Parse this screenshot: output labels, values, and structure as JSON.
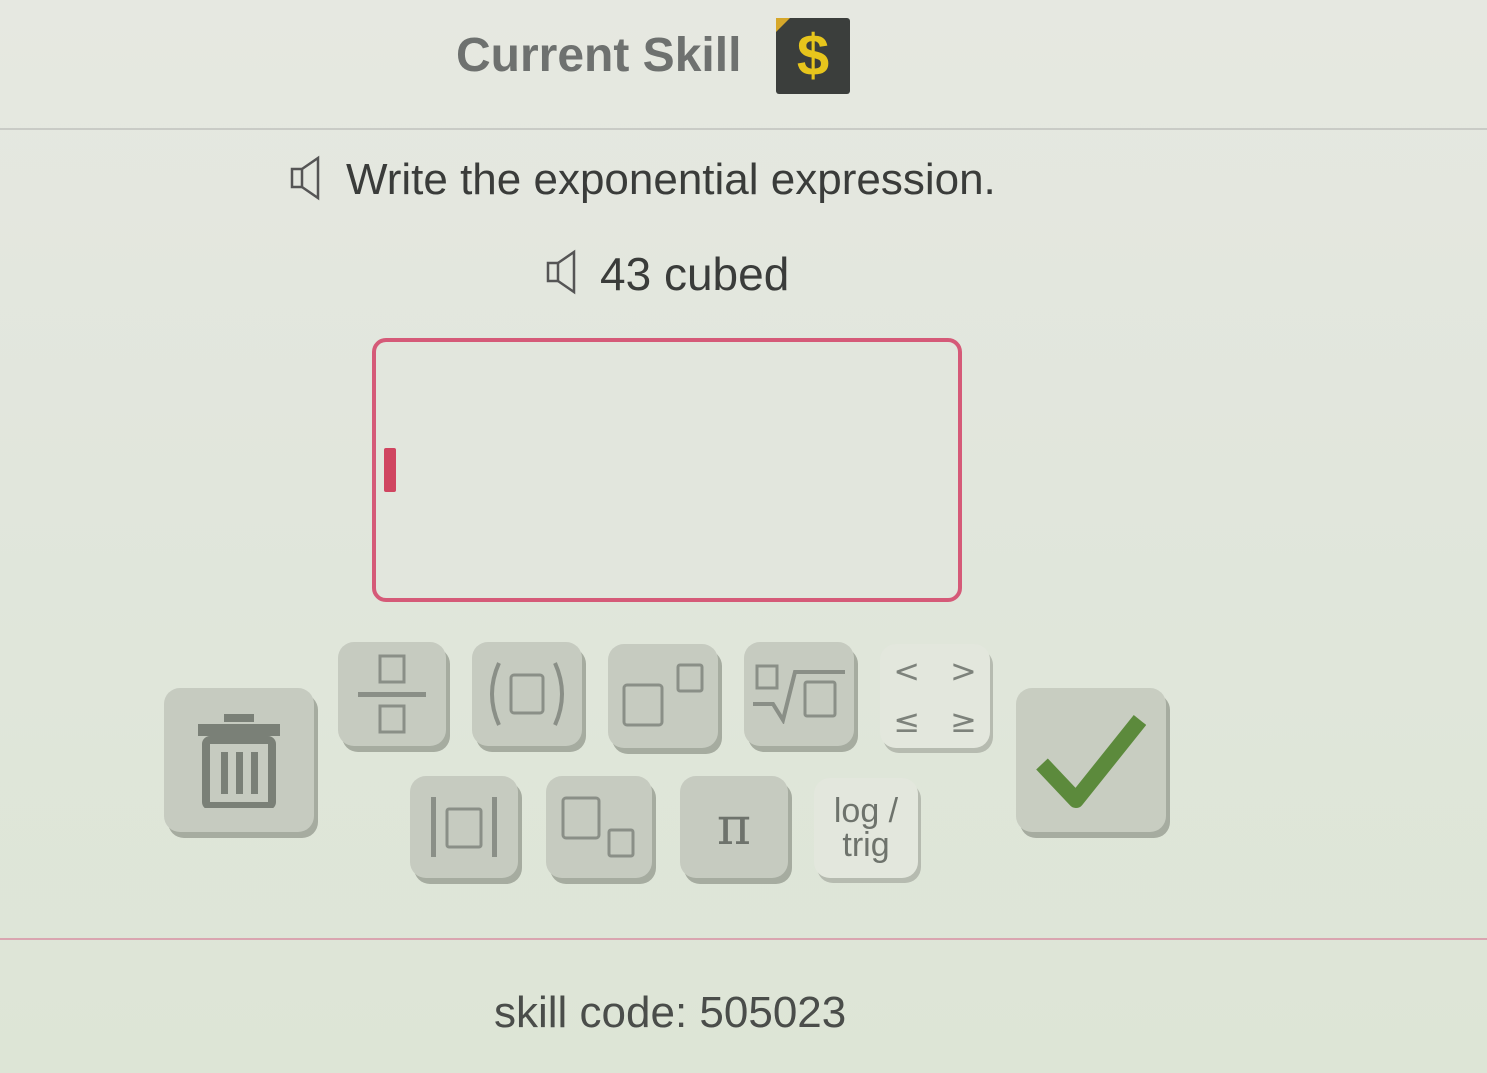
{
  "header": {
    "title": "Current Skill",
    "badge_icon": "dollar-badge-icon",
    "badge_symbol": "$",
    "badge_color": "#e7c51c"
  },
  "question": {
    "instruction": "Write the exponential expression.",
    "prompt": "43 cubed",
    "audio_icon": "speaker-icon"
  },
  "answer": {
    "value": "",
    "border_color": "#d55a78"
  },
  "keypad": {
    "delete_icon": "trash-icon",
    "keys_row1": [
      "fraction",
      "parentheses",
      "exponent",
      "nth-root",
      "comparison"
    ],
    "keys_row2": [
      "absolute-value",
      "subscript",
      "pi",
      "log-trig"
    ],
    "pi_label": "π",
    "log_trig_line1": "log /",
    "log_trig_line2": "trig",
    "comparison_symbols": [
      "<",
      ">",
      "≤",
      "≥"
    ],
    "submit_icon": "checkmark-icon",
    "submit_color": "#5c8a3c"
  },
  "footer": {
    "skill_code": "skill code: 505023"
  }
}
